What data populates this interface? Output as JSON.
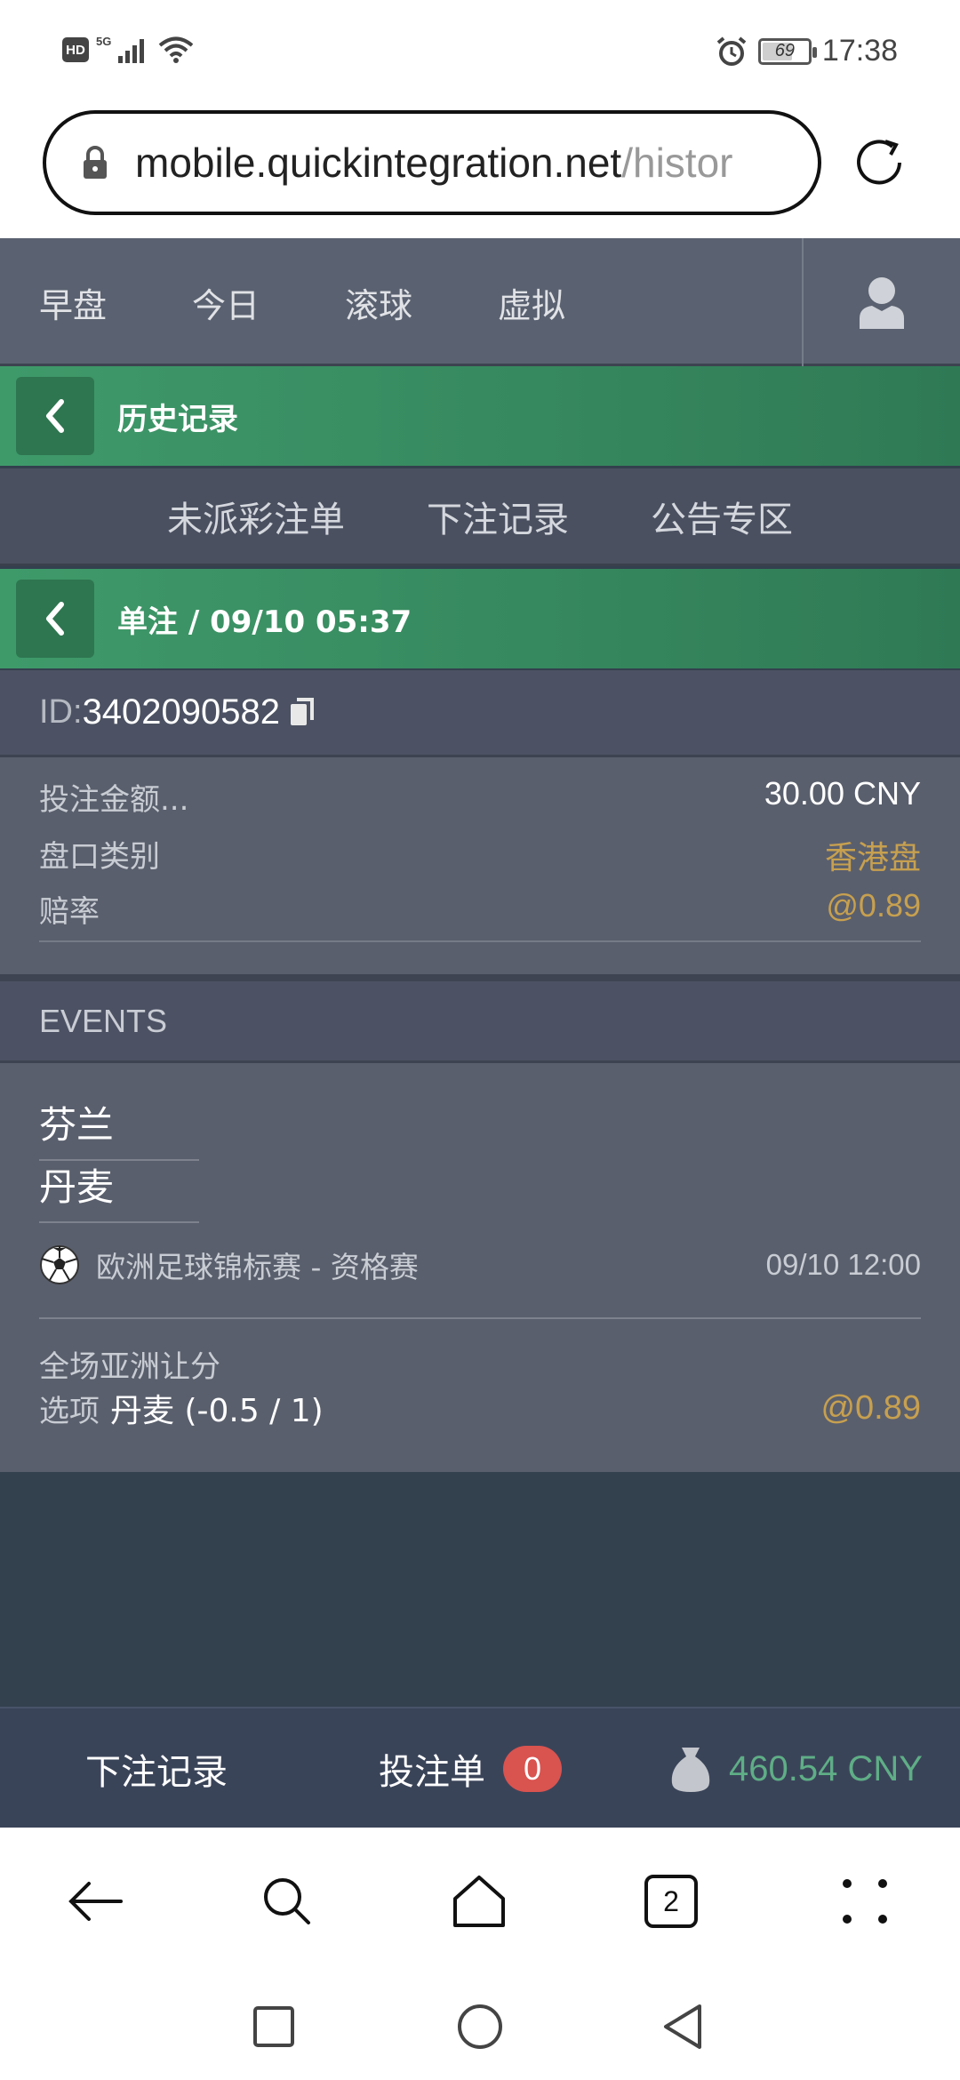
{
  "status": {
    "network": "5G",
    "hd": "HD",
    "battery": "69",
    "battery_level": 0.69,
    "time": "17:38"
  },
  "browser": {
    "url_host": "mobile.quickintegration.net",
    "url_path": "/histor",
    "tab_count": "2"
  },
  "nav": {
    "tabs": [
      "早盘",
      "今日",
      "滚球",
      "虚拟"
    ]
  },
  "history": {
    "title": "历史记录"
  },
  "subnav": {
    "items": [
      "未派彩注单",
      "下注记录",
      "公告专区"
    ]
  },
  "bet": {
    "header": "单注 / 09/10 05:37",
    "id_label": "ID:",
    "id_value": "3402090582",
    "stake_label": "投注金额...",
    "stake_value": "30.00 CNY",
    "odds_type_label": "盘口类别",
    "odds_type_value": "香港盘",
    "odds_label": "赔率",
    "odds_value": "@0.89"
  },
  "events": {
    "header": "EVENTS",
    "home": "芬兰",
    "away": "丹麦",
    "league": "欧洲足球锦标赛 - 资格赛",
    "time": "09/10 12:00",
    "market": "全场亚洲让分",
    "selection_label": "选项",
    "selection_value": "丹麦 (-0.5 / 1)",
    "selection_odds": "@0.89"
  },
  "bottom": {
    "records": "下注记录",
    "betslip": "投注单",
    "betslip_count": "0",
    "balance": "460.54 CNY"
  },
  "colors": {
    "green": "#3f9a6a",
    "gold": "#c7a04f",
    "badge": "#d9534f",
    "balance": "#5fae86"
  }
}
